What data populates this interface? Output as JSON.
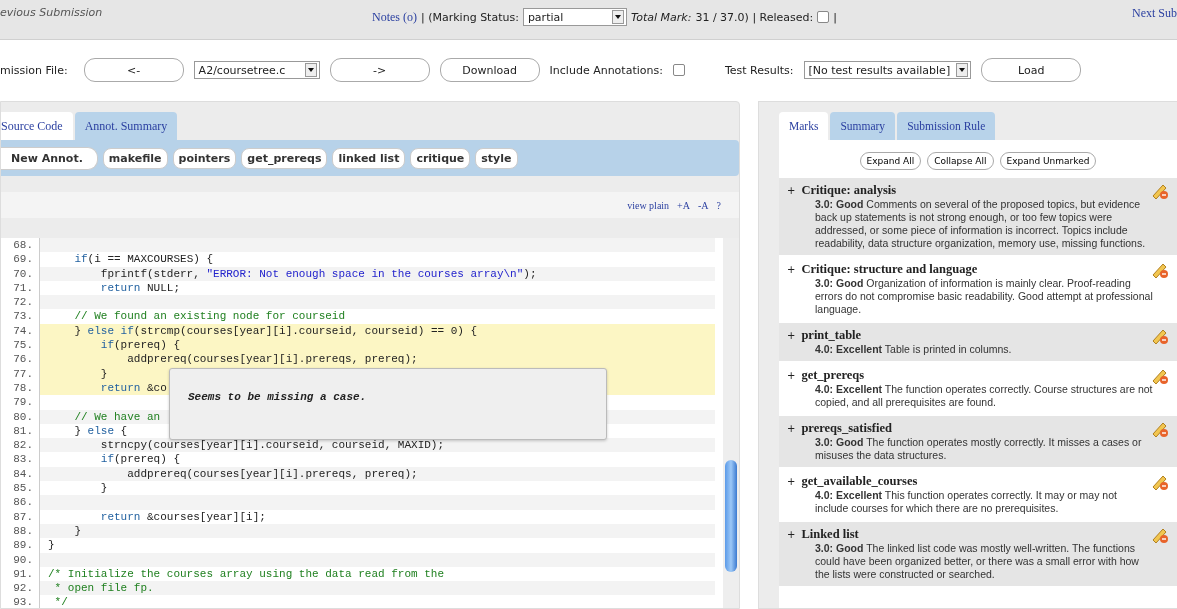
{
  "top_bar": {
    "previous": "evious Submission",
    "notes_link": "Notes (o)",
    "marking_status_label": "| (Marking Status:",
    "marking_status": "partial",
    "total_mark_label": "Total Mark:",
    "total_mark": "31 / 37.0) | Released:",
    "released": false,
    "separator": "|",
    "next": "Next Sub"
  },
  "file_bar": {
    "label": "mission File:",
    "prev_button": "<-",
    "file": "A2/coursetree.c",
    "next_button": "->",
    "download_button": "Download",
    "include_annotations_label": "Include Annotations:",
    "include_annotations": false,
    "test_results_label": "Test Results:",
    "test_results": "[No test results available]",
    "load_button": "Load"
  },
  "left_tabs": [
    {
      "label": "Source Code",
      "selected": true
    },
    {
      "label": "Annot. Summary",
      "selected": false
    }
  ],
  "annotation_buttons": [
    {
      "label": "New Annot.",
      "kind": "primary"
    },
    {
      "label": "makefile",
      "kind": "category"
    },
    {
      "label": "pointers",
      "kind": "category"
    },
    {
      "label": "get_prereqs",
      "kind": "category"
    },
    {
      "label": "linked list",
      "kind": "category"
    },
    {
      "label": "critique",
      "kind": "category"
    },
    {
      "label": "style",
      "kind": "category"
    }
  ],
  "view_links": [
    "view plain",
    "+A",
    "-A",
    "?"
  ],
  "code": [
    {
      "number": "68.",
      "highlighted": false
    },
    {
      "number": "69.",
      "highlighted": false,
      "segments": [
        {
          "kind": "keyword",
          "text": "    if"
        },
        {
          "kind": "plain",
          "text": "(i == MAXCOURSES) {"
        }
      ]
    },
    {
      "number": "70.",
      "highlighted": false,
      "segments": [
        {
          "kind": "plain",
          "text": "        fprintf(stderr, "
        },
        {
          "kind": "string",
          "text": "\"ERROR: Not enough space in the courses array\\n\""
        },
        {
          "kind": "plain",
          "text": ");"
        }
      ]
    },
    {
      "number": "71.",
      "highlighted": false,
      "segments": [
        {
          "kind": "keyword",
          "text": "        return"
        },
        {
          "kind": "plain",
          "text": " NULL;"
        }
      ]
    },
    {
      "number": "72.",
      "highlighted": false
    },
    {
      "number": "73.",
      "highlighted": false,
      "segments": [
        {
          "kind": "comment",
          "text": "    // We found an existing node for courseid"
        }
      ]
    },
    {
      "number": "74.",
      "highlighted": true,
      "segments": [
        {
          "kind": "plain",
          "text": "    } "
        },
        {
          "kind": "keyword",
          "text": "else if"
        },
        {
          "kind": "plain",
          "text": "(strcmp(courses[year][i].courseid, courseid) == 0) {"
        }
      ]
    },
    {
      "number": "75.",
      "highlighted": true,
      "segments": [
        {
          "kind": "keyword",
          "text": "        if"
        },
        {
          "kind": "plain",
          "text": "(prereq) {"
        }
      ]
    },
    {
      "number": "76.",
      "highlighted": true,
      "segments": [
        {
          "kind": "plain",
          "text": "            addprereq(courses[year][i].prereqs, prereq);"
        }
      ]
    },
    {
      "number": "77.",
      "highlighted": true,
      "segments": [
        {
          "kind": "plain",
          "text": "        }"
        }
      ]
    },
    {
      "number": "78.",
      "highlighted": true,
      "segments": [
        {
          "kind": "keyword",
          "text": "        return"
        },
        {
          "kind": "plain",
          "text": " &co"
        }
      ]
    },
    {
      "number": "79.",
      "highlighted": false
    },
    {
      "number": "80.",
      "highlighted": false,
      "segments": [
        {
          "kind": "comment",
          "text": "    // We have an"
        }
      ]
    },
    {
      "number": "81.",
      "highlighted": false,
      "segments": [
        {
          "kind": "plain",
          "text": "    } "
        },
        {
          "kind": "keyword",
          "text": "else"
        },
        {
          "kind": "plain",
          "text": " {"
        }
      ]
    },
    {
      "number": "82.",
      "highlighted": false,
      "segments": [
        {
          "kind": "plain",
          "text": "        strncpy(courses[year][i].courseid, courseid, MAXID);"
        }
      ]
    },
    {
      "number": "83.",
      "highlighted": false,
      "segments": [
        {
          "kind": "keyword",
          "text": "        if"
        },
        {
          "kind": "plain",
          "text": "(prereq) {"
        }
      ]
    },
    {
      "number": "84.",
      "highlighted": false,
      "segments": [
        {
          "kind": "plain",
          "text": "            addprereq(courses[year][i].prereqs, prereq);"
        }
      ]
    },
    {
      "number": "85.",
      "highlighted": false,
      "segments": [
        {
          "kind": "plain",
          "text": "        }"
        }
      ]
    },
    {
      "number": "86.",
      "highlighted": false
    },
    {
      "number": "87.",
      "highlighted": false,
      "segments": [
        {
          "kind": "keyword",
          "text": "        return"
        },
        {
          "kind": "plain",
          "text": " &courses[year][i];"
        }
      ]
    },
    {
      "number": "88.",
      "highlighted": false,
      "segments": [
        {
          "kind": "plain",
          "text": "    }"
        }
      ]
    },
    {
      "number": "89.",
      "highlighted": false,
      "segments": [
        {
          "kind": "plain",
          "text": "}"
        }
      ]
    },
    {
      "number": "90.",
      "highlighted": false
    },
    {
      "number": "91.",
      "highlighted": false,
      "segments": [
        {
          "kind": "comment",
          "text": "/* Initialize the courses array using the data read from the"
        }
      ]
    },
    {
      "number": "92.",
      "highlighted": false,
      "segments": [
        {
          "kind": "comment",
          "text": " * open file fp."
        }
      ]
    },
    {
      "number": "93.",
      "highlighted": false,
      "segments": [
        {
          "kind": "comment",
          "text": " */"
        }
      ]
    }
  ],
  "annotation_tooltip": "Seems to be missing a case.",
  "right_tabs": [
    {
      "label": "Marks",
      "selected": true
    },
    {
      "label": "Summary",
      "selected": false
    },
    {
      "label": "Submission Rule",
      "selected": false
    }
  ],
  "mark_buttons": [
    "Expand All",
    "Collapse All",
    "Expand Unmarked"
  ],
  "marks": [
    {
      "expander": "+",
      "title": "Critique: analysis",
      "text": "**3.0: Good** Comments on several of the proposed topics, but evidence back up statements is not strong enough, or too few topics were addressed, or some piece of information is incorrect. Topics include readability, data structure organization, memory use, missing functions."
    },
    {
      "expander": "+",
      "title": "Critique: structure and language",
      "text": "**3.0: Good** Organization of information is mainly clear. Proof-reading errors do not compromise basic readability. Good attempt at professional language."
    },
    {
      "expander": "+",
      "title": "print_table",
      "text": "**4.0: Excellent** Table is printed in columns."
    },
    {
      "expander": "+",
      "title": "get_prereqs",
      "text": "**4.0: Excellent** The function operates correctly. Course structures are not copied, and all prerequisites are found."
    },
    {
      "expander": "+",
      "title": "prereqs_satisfied",
      "text": "**3.0: Good** The function operates mostly correctly. It misses a cases or misuses the data structures."
    },
    {
      "expander": "+",
      "title": "get_available_courses",
      "text": "**4.0: Excellent** This function operates correctly. It may or may not include courses for which there are no prerequisites."
    },
    {
      "expander": "+",
      "title": "Linked list",
      "text": "**3.0: Good** The linked list code was mostly well-written. The functions could have been organized better, or there was a small error with how the lists were constructed or searched."
    }
  ]
}
